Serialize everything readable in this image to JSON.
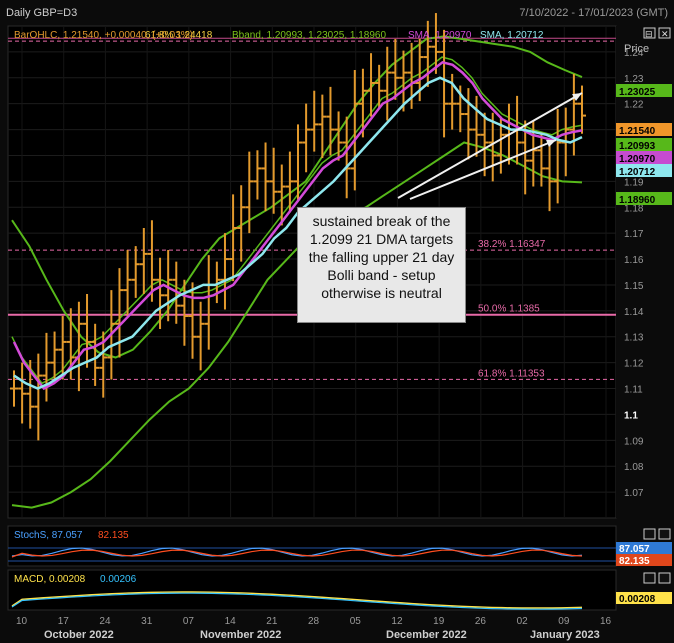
{
  "header": {
    "title": "Daily GBP=D3",
    "range": "7/10/2022 - 17/01/2023 (GMT)"
  },
  "panes": {
    "main": {
      "legend": [
        {
          "text": "BarOHLC, 1.21540, +0.00040, (+0.03%)",
          "color": "#e39a2d"
        },
        {
          "text": "Bband, 1.20993, 1.23025, 1.18960",
          "color": "#7bc21a"
        },
        {
          "text": "SMA, 1.20970",
          "color": "#d34bd9"
        },
        {
          "text": "SMA, 1.20712",
          "color": "#8ee7ee"
        }
      ],
      "price_label": "Price",
      "close_buttons": [
        "⊟",
        "✕"
      ]
    },
    "stoch": {
      "legend": [
        {
          "text": "StochS, 87.057",
          "color": "#4aa0ff"
        },
        {
          "text": "82.135",
          "color": "#ff4d1f"
        }
      ],
      "tags": [
        {
          "text": "87.057",
          "bg": "#2f7ad6",
          "fg": "#ffffff"
        },
        {
          "text": "82.135",
          "bg": "#e0471c",
          "fg": "#ffffff"
        }
      ]
    },
    "macd": {
      "legend": [
        {
          "text": "MACD, 0.00208",
          "color": "#ffe24a"
        },
        {
          "text": "0.00206",
          "color": "#35c3ff"
        }
      ],
      "tags": [
        {
          "text": "0.00208",
          "bg": "#ffe24a",
          "fg": "#000000"
        }
      ]
    }
  },
  "annotation": {
    "text": "sustained break of the 1.2099 21 DMA targets the  falling upper 21 day Bolli band - setup otherwise is neutral"
  },
  "price_tags": [
    {
      "text": "1.23025",
      "value": 1.23025,
      "bg": "#57b81a",
      "fg": "#000000"
    },
    {
      "text": "1.21540",
      "value": 1.2154,
      "bg": "#f0962a",
      "fg": "#000000"
    },
    {
      "text": "1.20993",
      "value": 1.20993,
      "bg": "#57b81a",
      "fg": "#000000"
    },
    {
      "text": "1.20970",
      "value": 1.2097,
      "bg": "#c64bd1",
      "fg": "#000000"
    },
    {
      "text": "1.20712",
      "value": 1.20712,
      "bg": "#8ee7ee",
      "fg": "#000000"
    },
    {
      "text": "1.18960",
      "value": 1.1896,
      "bg": "#57b81a",
      "fg": "#000000"
    }
  ],
  "chart_data": {
    "type": "line",
    "title": "Daily GBP=D3",
    "ylim": [
      1.06,
      1.25
    ],
    "y_ticks": [
      "1.24",
      "1.23",
      "1.22",
      "1.21",
      "1.2",
      "1.19",
      "1.18",
      "1.17",
      "1.16",
      "1.15",
      "1.14",
      "1.13",
      "1.12",
      "1.11",
      "1.1",
      "1.09",
      "1.08",
      "1.07"
    ],
    "x_ticks": [
      "10",
      "17",
      "24",
      "31",
      "07",
      "14",
      "21",
      "28",
      "05",
      "12",
      "19",
      "26",
      "02",
      "09",
      "16"
    ],
    "x_months": [
      "October 2022",
      "November 2022",
      "December 2022",
      "January 2023"
    ],
    "fib_levels": [
      {
        "label": "61.8%  1.24418",
        "value": 1.24418,
        "color": "#e86aa8"
      },
      {
        "label": "38.2%  1.16347",
        "value": 1.16347,
        "color": "#e86aa8"
      },
      {
        "label": "50.0%  1.1385",
        "value": 1.1385,
        "color": "#e86aa8"
      },
      {
        "label": "61.8%  1.11353",
        "value": 1.11353,
        "color": "#e86aa8"
      }
    ],
    "top_fib_label": "61.8%  1.24418",
    "series": [
      {
        "name": "BarOHLC",
        "color": "#e39a2d",
        "values": [
          1.11,
          1.108,
          1.103,
          1.115,
          1.12,
          1.125,
          1.128,
          1.122,
          1.135,
          1.128,
          1.118,
          1.122,
          1.135,
          1.148,
          1.152,
          1.158,
          1.162,
          1.152,
          1.146,
          1.152,
          1.142,
          1.138,
          1.13,
          1.135,
          1.15,
          1.152,
          1.16,
          1.172,
          1.18,
          1.19,
          1.195,
          1.19,
          1.186,
          1.188,
          1.19,
          1.205,
          1.21,
          1.212,
          1.215,
          1.21,
          1.205,
          1.195,
          1.22,
          1.225,
          1.228,
          1.225,
          1.232,
          1.23,
          1.232,
          1.228,
          1.238,
          1.242,
          1.24,
          1.22,
          1.22,
          1.216,
          1.21,
          1.208,
          1.205,
          1.2,
          1.208,
          1.21,
          1.205,
          1.198,
          1.202,
          1.195,
          1.19,
          1.205,
          1.21,
          1.22,
          1.2154
        ]
      },
      {
        "name": "SMA 21",
        "color": "#d34bd9",
        "values": [
          1.128,
          1.12,
          1.115,
          1.11,
          1.112,
          1.115,
          1.12,
          1.125,
          1.126,
          1.128,
          1.132,
          1.136,
          1.14,
          1.144,
          1.148,
          1.15,
          1.148,
          1.146,
          1.145,
          1.145,
          1.146,
          1.148,
          1.15,
          1.155,
          1.16,
          1.165,
          1.17,
          1.175,
          1.18,
          1.185,
          1.19,
          1.195,
          1.198,
          1.2,
          1.205,
          1.21,
          1.215,
          1.22,
          1.222,
          1.225,
          1.228,
          1.23,
          1.233,
          1.236,
          1.235,
          1.232,
          1.228,
          1.222,
          1.218,
          1.214,
          1.212,
          1.21,
          1.208,
          1.207,
          1.206,
          1.208,
          1.209,
          1.2097
        ]
      },
      {
        "name": "SMA",
        "color": "#8ee7ee",
        "values": [
          1.115,
          1.112,
          1.11,
          1.112,
          1.115,
          1.118,
          1.12,
          1.122,
          1.126,
          1.128,
          1.13,
          1.135,
          1.14,
          1.143,
          1.146,
          1.148,
          1.15,
          1.15,
          1.152,
          1.154,
          1.158,
          1.162,
          1.168,
          1.172,
          1.178,
          1.182,
          1.186,
          1.19,
          1.195,
          1.2,
          1.205,
          1.21,
          1.215,
          1.22,
          1.224,
          1.228,
          1.23,
          1.228,
          1.222,
          1.218,
          1.214,
          1.212,
          1.21,
          1.21,
          1.209,
          1.208,
          1.206,
          1.205,
          1.2071
        ]
      },
      {
        "name": "Bband upper",
        "color": "#57b81a",
        "values": [
          1.175,
          1.165,
          1.152,
          1.14,
          1.13,
          1.124,
          1.122,
          1.125,
          1.132,
          1.14,
          1.15,
          1.16,
          1.168,
          1.172,
          1.176,
          1.18,
          1.185,
          1.19,
          1.2,
          1.21,
          1.22,
          1.228,
          1.235,
          1.24,
          1.245,
          1.246,
          1.245,
          1.244,
          1.243,
          1.242,
          1.24,
          1.236,
          1.233,
          1.23025
        ]
      },
      {
        "name": "Bband lower",
        "color": "#57b81a",
        "values": [
          1.065,
          1.064,
          1.066,
          1.07,
          1.075,
          1.082,
          1.09,
          1.098,
          1.105,
          1.11,
          1.118,
          1.128,
          1.14,
          1.152,
          1.16,
          1.168,
          1.172,
          1.176,
          1.18,
          1.185,
          1.19,
          1.195,
          1.2,
          1.205,
          1.203,
          1.2,
          1.196,
          1.192,
          1.19,
          1.1896
        ]
      }
    ],
    "stoch": {
      "k_last": 87.057,
      "d_last": 82.135
    },
    "macd": {
      "macd_last": 0.00208,
      "signal_last": 0.00206
    }
  }
}
